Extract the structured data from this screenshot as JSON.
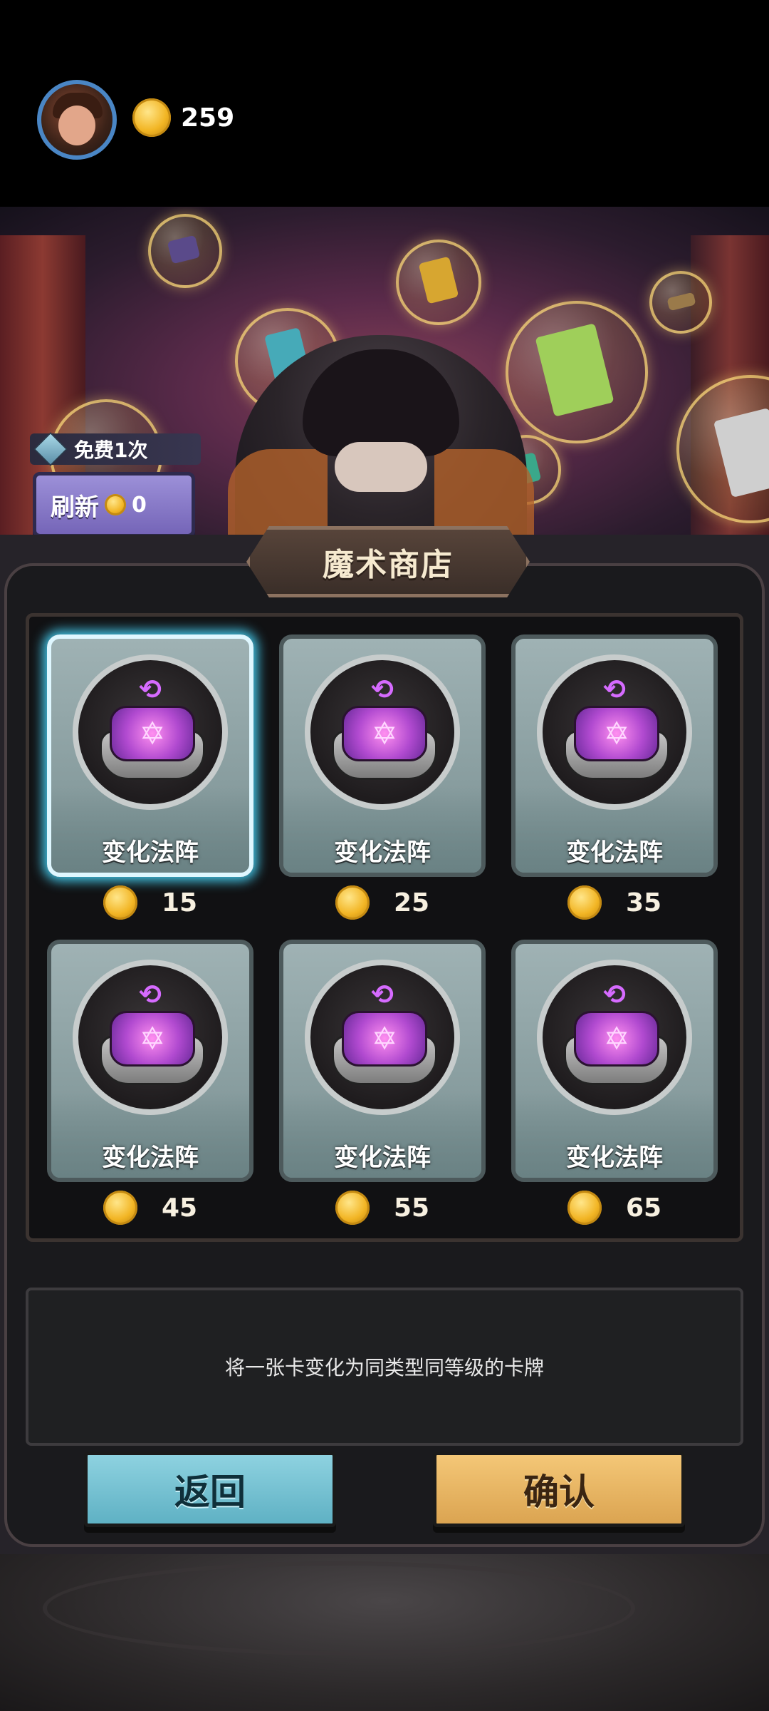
{
  "header": {
    "gold_amount": "259",
    "avatar_icon": "player-avatar",
    "coin_icon": "gold-coin-icon"
  },
  "refresh": {
    "free_label": "免费1次",
    "button_label": "刷新",
    "cost": "0"
  },
  "shop": {
    "title": "魔术商店",
    "items": [
      {
        "name": "变化法阵",
        "price": "15",
        "selected": true
      },
      {
        "name": "变化法阵",
        "price": "25",
        "selected": false
      },
      {
        "name": "变化法阵",
        "price": "35",
        "selected": false
      },
      {
        "name": "变化法阵",
        "price": "45",
        "selected": false
      },
      {
        "name": "变化法阵",
        "price": "55",
        "selected": false
      },
      {
        "name": "变化法阵",
        "price": "65",
        "selected": false
      }
    ],
    "description": "将一张卡变化为同类型同等级的卡牌"
  },
  "actions": {
    "back_label": "返回",
    "confirm_label": "确认"
  },
  "colors": {
    "selected_glow": "#43c5e6",
    "back_button": "#6fc0d2",
    "confirm_button": "#e8b562",
    "refresh_button": "#8a7cc8"
  }
}
